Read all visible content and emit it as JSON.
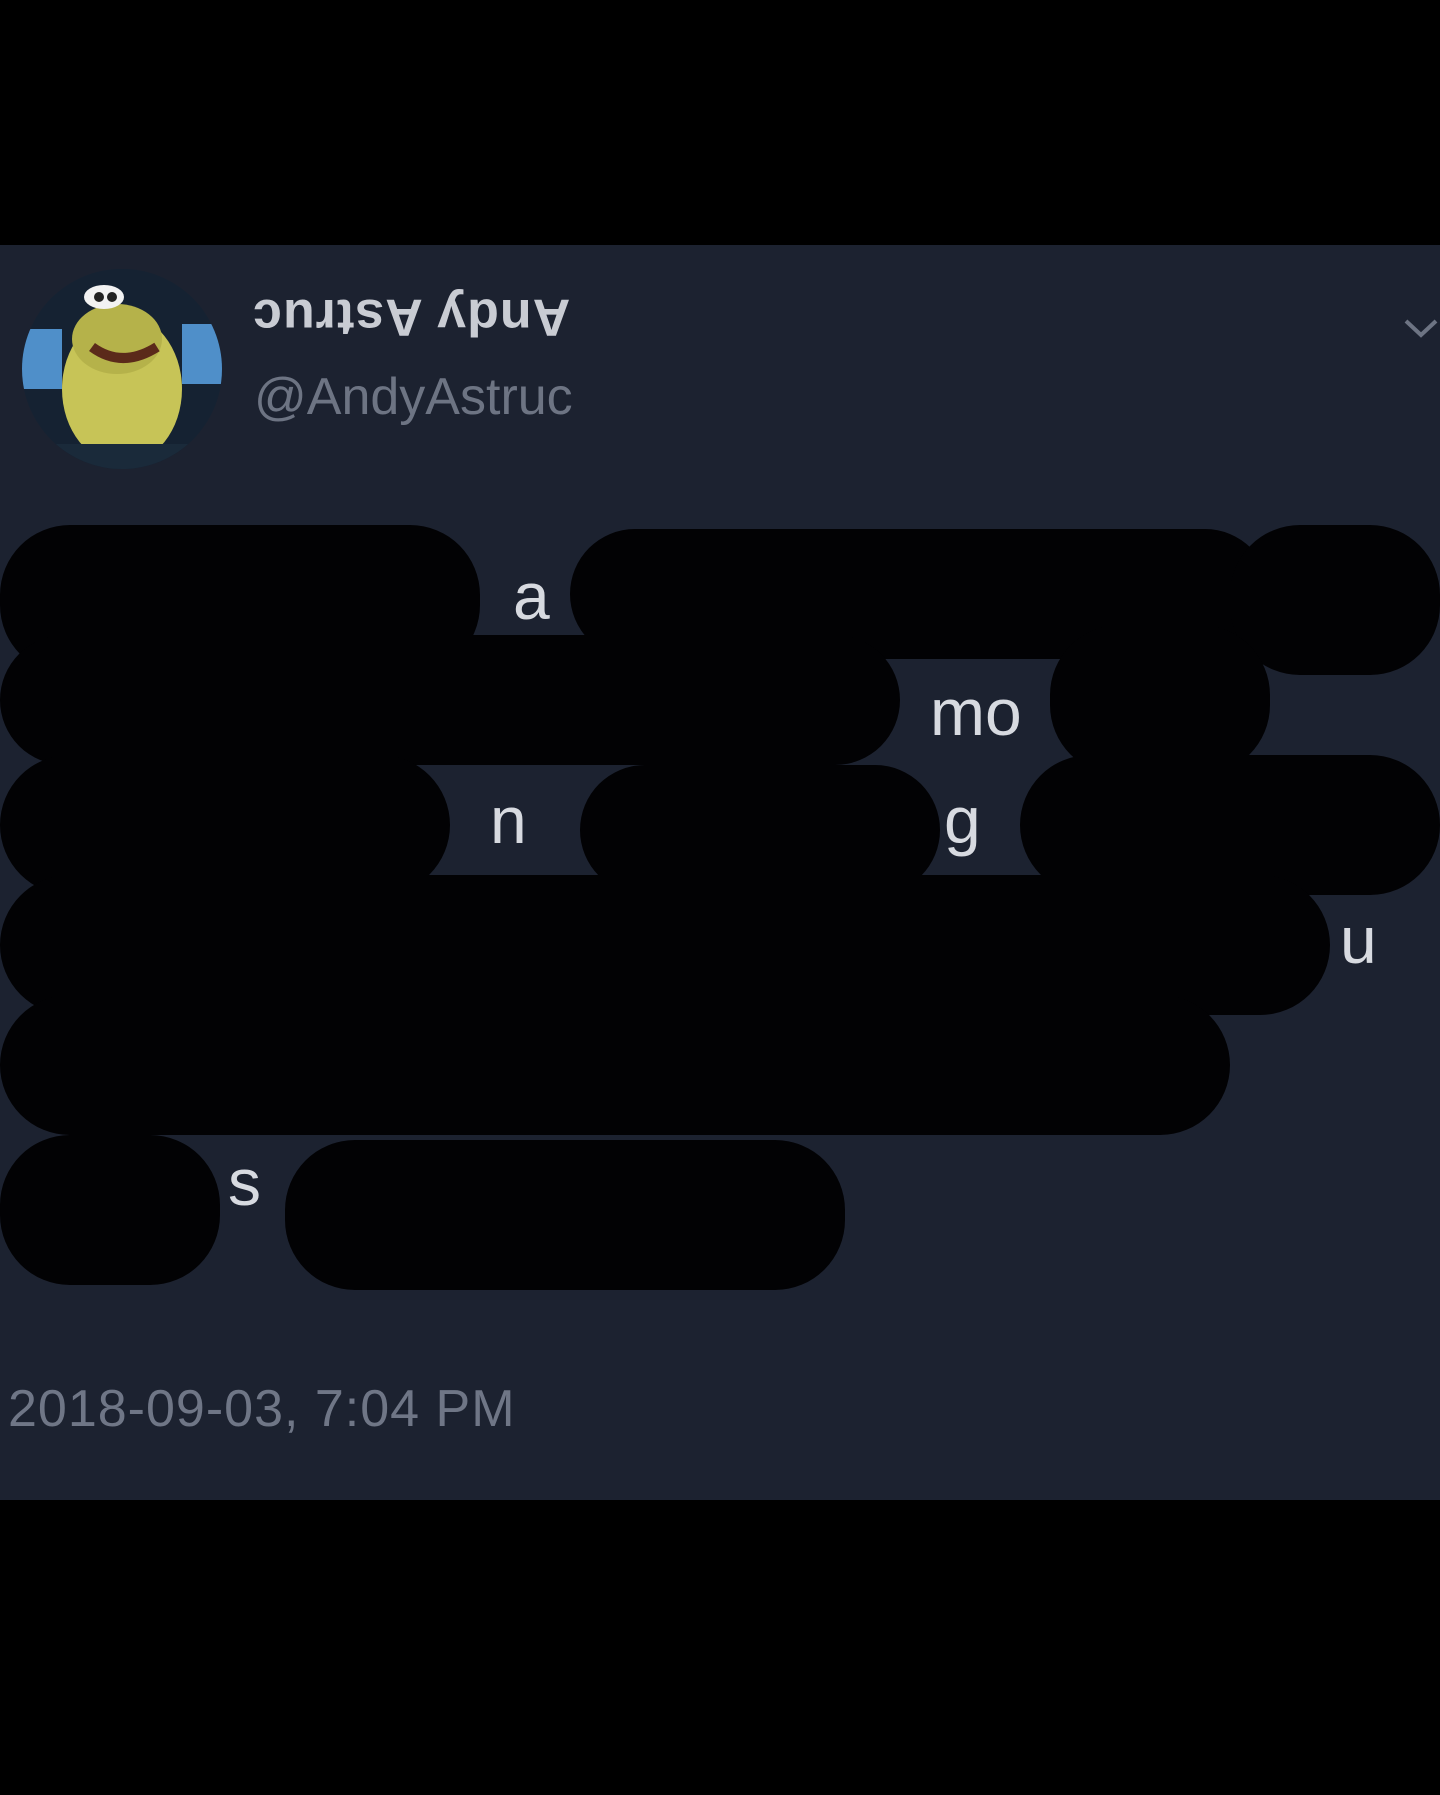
{
  "tweet": {
    "display_name": "Andy Astruc",
    "handle": "@AndyAstruc",
    "timestamp": "2018-09-03, 7:04 PM",
    "visible_letters": [
      "a",
      "mo",
      "n",
      "g",
      "u",
      "s"
    ],
    "avatar_icon": "cartoon-character-avatar",
    "menu_icon": "chevron-down-icon"
  },
  "colors": {
    "background": "#000000",
    "card": "#1c2230",
    "redaction": "#020204",
    "name_text": "#c9ccd3",
    "secondary_text": "#6f7686"
  }
}
